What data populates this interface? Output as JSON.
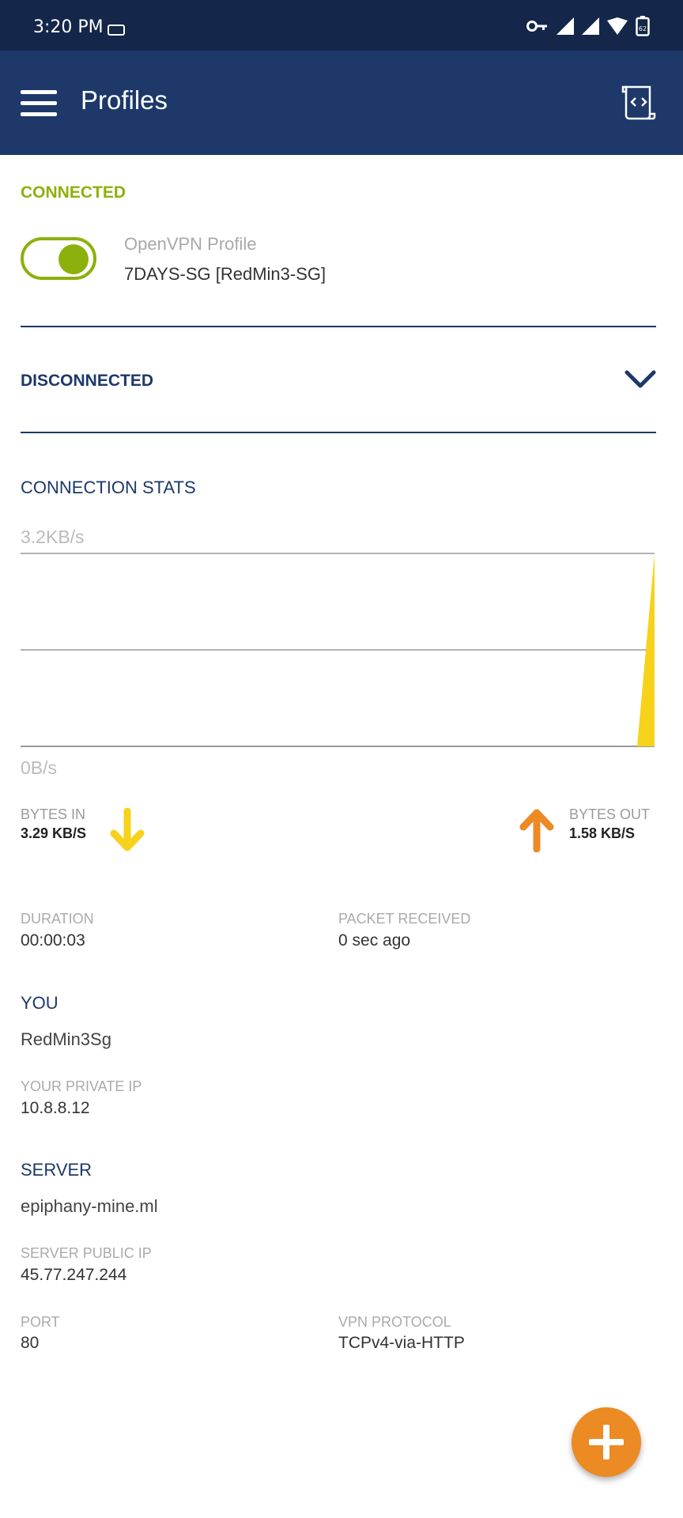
{
  "status_bar": {
    "time": "3:20 PM",
    "battery_level": "62",
    "icons": [
      "key-icon",
      "signal-icon",
      "signal-icon",
      "wifi-icon",
      "battery-icon"
    ]
  },
  "app_bar": {
    "title": "Profiles",
    "menu_icon": "menu-icon",
    "import_icon": "import-profile-icon"
  },
  "connected": {
    "label": "CONNECTED",
    "profile_type": "OpenVPN Profile",
    "profile_name": "7DAYS-SG [RedMin3-SG]",
    "toggle_on": true
  },
  "disconnected": {
    "label": "DISCONNECTED"
  },
  "stats": {
    "label": "CONNECTION STATS",
    "max_label": "3.2KB/s",
    "min_label": "0B/s",
    "bytes_in_label": "BYTES IN",
    "bytes_in_value": "3.29 KB/S",
    "bytes_out_label": "BYTES OUT",
    "bytes_out_value": "1.58 KB/S"
  },
  "chart_data": {
    "type": "area",
    "ylim": [
      0,
      3.2
    ],
    "series": [
      {
        "values": [
          0,
          0,
          0,
          0,
          0,
          0,
          0,
          0,
          0,
          0,
          0,
          0,
          0,
          0,
          0,
          0,
          0,
          0,
          0,
          3.2
        ]
      }
    ]
  },
  "details": {
    "duration_label": "DURATION",
    "duration_value": "00:00:03",
    "packet_label": "PACKET RECEIVED",
    "packet_value": "0 sec ago",
    "you_title": "YOU",
    "you_value": "RedMin3Sg",
    "private_ip_label": "YOUR PRIVATE IP",
    "private_ip_value": "10.8.8.12",
    "server_title": "SERVER",
    "server_value": "epiphany-mine.ml",
    "public_ip_label": "SERVER PUBLIC IP",
    "public_ip_value": "45.77.247.244",
    "port_label": "PORT",
    "port_value": "80",
    "protocol_label": "VPN PROTOCOL",
    "protocol_value": "TCPv4-via-HTTP"
  },
  "colors": {
    "app_bar": "#1d3869",
    "status_bar": "#14274a",
    "connected_green": "#8cb10c",
    "bytes_in_yellow": "#f7d21a",
    "bytes_out_orange": "#ec8a24",
    "fab_orange": "#ec8a24"
  }
}
